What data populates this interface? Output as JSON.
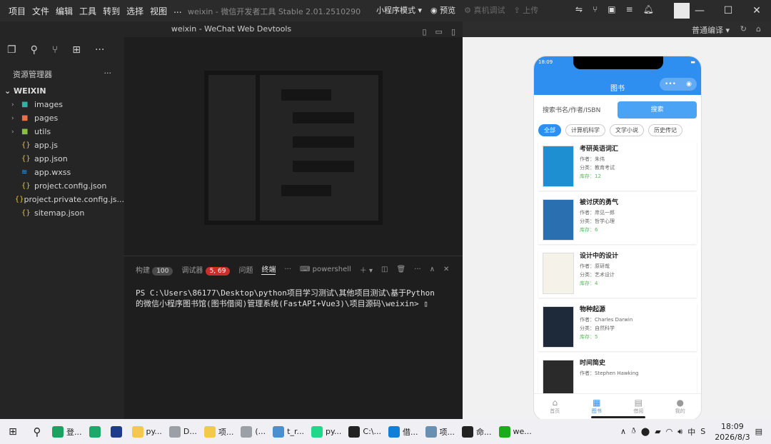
{
  "menu": [
    "项目",
    "文件",
    "编辑",
    "工具",
    "转到",
    "选择",
    "视图",
    "..."
  ],
  "app_title": "weixin - 微信开发者工具 Stable 2.01.2510290",
  "toolbar": {
    "mode": "小程序模式",
    "preview": "预览",
    "real_debug": "真机调试",
    "upload": "上传"
  },
  "second_title": "weixin - WeChat Web Devtools",
  "compile_mode": "普通编译",
  "explorer": {
    "title": "资源管理器",
    "root": "WEIXIN",
    "items": [
      {
        "name": "images",
        "type": "folder",
        "icon": "folder-icon",
        "color": "#2bb3a3"
      },
      {
        "name": "pages",
        "type": "folder",
        "icon": "folder-icon",
        "color": "#e8704a"
      },
      {
        "name": "utils",
        "type": "folder",
        "icon": "folder-icon",
        "color": "#8bbf3f"
      },
      {
        "name": "app.js",
        "type": "file",
        "icon": "js-file-icon",
        "color": "#e5c23a"
      },
      {
        "name": "app.json",
        "type": "file",
        "icon": "json-file-icon",
        "color": "#e5c23a"
      },
      {
        "name": "app.wxss",
        "type": "file",
        "icon": "css-file-icon",
        "color": "#4a9fe0"
      },
      {
        "name": "project.config.json",
        "type": "file",
        "icon": "json-file-icon",
        "color": "#e5c23a"
      },
      {
        "name": "project.private.config.js...",
        "type": "file",
        "icon": "json-file-icon",
        "color": "#e5c23a"
      },
      {
        "name": "sitemap.json",
        "type": "file",
        "icon": "json-file-icon",
        "color": "#e5c23a"
      }
    ]
  },
  "panel": {
    "tabs": {
      "console": "构建",
      "console_count": "100",
      "debugger": "调试器",
      "debugger_count": "5, 69",
      "problems": "问题",
      "terminal": "终端",
      "shell": "powershell"
    },
    "terminal_lines": [
      "PS C:\\Users\\86177\\Desktop\\python项目学习测试\\其他项目测试\\基于Python",
      "的微信小程序图书馆(图书借阅)管理系统(FastAPI+Vue3)\\项目源码\\weixin> ▯"
    ]
  },
  "phone": {
    "time": "18:09",
    "title": "图书",
    "search_placeholder": "搜索书名/作者/ISBN",
    "search_button": "搜索",
    "categories": [
      "全部",
      "计算机科学",
      "文学小说",
      "历史传记"
    ],
    "books": [
      {
        "title": "考研英语词汇",
        "author": "作者：朱伟",
        "category": "分类：教育考试",
        "stock": "库存：12",
        "cover": "#1e8fd0"
      },
      {
        "title": "被讨厌的勇气",
        "author": "作者：岸见一郎",
        "category": "分类：哲学心理",
        "stock": "库存：6",
        "cover": "#2a6fb0"
      },
      {
        "title": "设计中的设计",
        "author": "作者：原研哉",
        "category": "分类：艺术设计",
        "stock": "库存：4",
        "cover": "#f5f2ea"
      },
      {
        "title": "物种起源",
        "author": "作者：Charles Darwin",
        "category": "分类：自然科学",
        "stock": "库存：5",
        "cover": "#1e2a3a"
      },
      {
        "title": "时间简史",
        "author": "作者：Stephen Hawking",
        "category": "",
        "stock": "",
        "cover": "#2a2a2a"
      }
    ],
    "tabbar": [
      {
        "label": "首页",
        "icon": "home-icon"
      },
      {
        "label": "图书",
        "icon": "book-icon"
      },
      {
        "label": "借阅",
        "icon": "clipboard-icon"
      },
      {
        "label": "我的",
        "icon": "user-icon"
      }
    ]
  },
  "taskbar": {
    "items": [
      {
        "label": "登...",
        "color": "#1aa260"
      },
      {
        "label": "",
        "color": "#1ea86a"
      },
      {
        "label": "",
        "color": "#1e3a8a"
      },
      {
        "label": "py...",
        "color": "#f2c94c"
      },
      {
        "label": "D...",
        "color": "#9aa0a6"
      },
      {
        "label": "项...",
        "color": "#f2c94c"
      },
      {
        "label": "(...",
        "color": "#9aa0a6"
      },
      {
        "label": "t_r...",
        "color": "#4a8fd0"
      },
      {
        "label": "py...",
        "color": "#21d789"
      },
      {
        "label": "C:\\...",
        "color": "#222222"
      },
      {
        "label": "借...",
        "color": "#0f7fd8"
      },
      {
        "label": "项...",
        "color": "#6a8fb0"
      },
      {
        "label": "命...",
        "color": "#222222"
      },
      {
        "label": "we...",
        "color": "#1aad19"
      }
    ],
    "time": "18:09",
    "date": "2026/8/3"
  }
}
